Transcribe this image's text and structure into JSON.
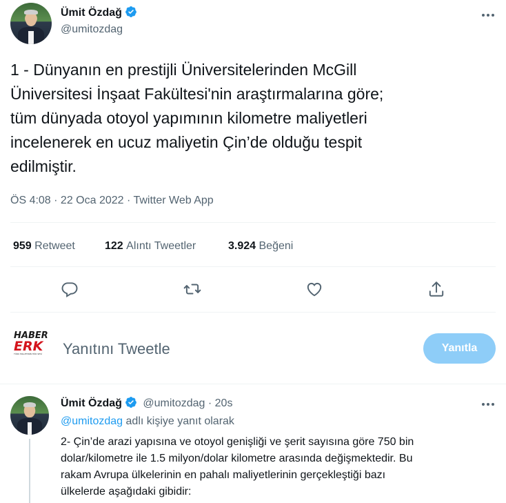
{
  "main_tweet": {
    "author_name": "Ümit Özdağ",
    "author_handle": "@umitozdag",
    "more_icon": "more-dots-icon",
    "text": "1 - Dünyanın en prestijli Üniversitelerinden McGill Üniversitesi İnşaat Fakültesi'nin araştırmalarına göre; tüm dünyada otoyol yapımının kilometre maliyetleri incelenerek en ucuz maliyetin Çin’de olduğu tespit edilmiştir.",
    "text_lines": [
      "1 - Dünyanın en prestijli Üniversitelerinden McGill",
      "Üniversitesi İnşaat Fakültesi'nin araştırmalarına göre;",
      "tüm dünyada otoyol yapımının kilometre maliyetleri",
      "incelenerek en ucuz maliyetin Çin’de olduğu tespit",
      "edilmiştir."
    ],
    "meta": "ÖS 4:08 · 22 Oca 2022 · Twitter Web App"
  },
  "stats": {
    "retweets_count": "959",
    "retweets_label": "Retweet",
    "quotes_count": "122",
    "quotes_label": "Alıntı Tweetler",
    "likes_count": "3.924",
    "likes_label": "Beğeni"
  },
  "actions": [
    "reply-icon",
    "retweet-icon",
    "like-icon",
    "share-icon"
  ],
  "reply_box": {
    "logo_line1": "HABER",
    "logo_line2": "ERK",
    "logo_tagline": "TÜRK MİLLETİNİN HÜR SESİ",
    "placeholder": "Yanıtını Tweetle",
    "button_label": "Yanıtla"
  },
  "reply_tweet": {
    "author_name": "Ümit Özdağ",
    "author_handle": "@umitozdag",
    "dot": "·",
    "time": "20s",
    "replying_to_handle": "@umitozdag",
    "replying_to_suffix": "adlı kişiye yanıt olarak",
    "text_lines": [
      "2- Çin’de arazi yapısına ve otoyol genişliği ve şerit sayısına göre 750 bin",
      "dolar/kilometre ile 1.5 milyon/dolar kilometre arasında değişmektedir.  Bu",
      "rakam Avrupa ülkelerinin en pahalı maliyetlerinin gerçekleştiği  bazı",
      "ülkelerde aşağıdaki gibidir:"
    ]
  },
  "colors": {
    "accent": "#1d9bf0",
    "button_disabled": "#8ecdf8",
    "secondary_text": "#536471",
    "separator": "#eff3f4"
  }
}
